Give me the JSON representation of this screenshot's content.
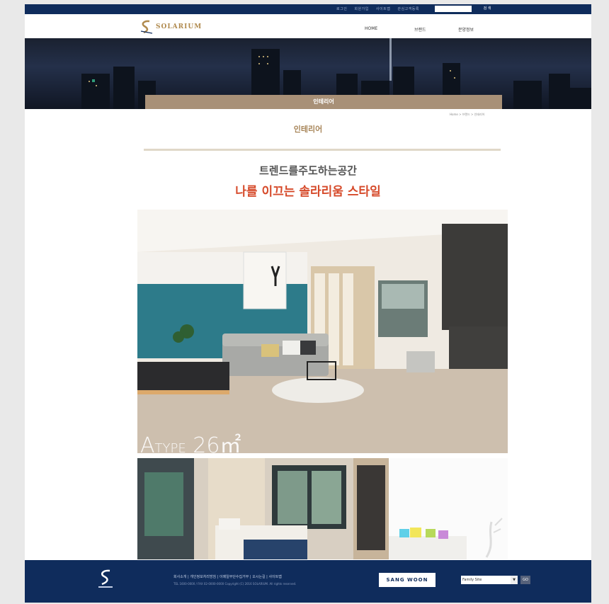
{
  "topbar": {
    "links": [
      "로그인",
      "회원가입",
      "사이트맵",
      "관심고객등록"
    ],
    "search_placeholder": "",
    "search_button": "검 색"
  },
  "header": {
    "logo_text": "SOLARIUM",
    "nav": [
      {
        "label": "HOME"
      },
      {
        "label": "브랜드"
      },
      {
        "label": "분양정보"
      }
    ]
  },
  "hero": {
    "tab_label": "인테리어"
  },
  "breadcrumb": "Home > 브랜드 > 인테리어",
  "section": {
    "title": "인테리어",
    "subtitle": "트렌드를주도하는공간",
    "headline": "나를 이끄는 솔라리움 스타일"
  },
  "photo": {
    "caption_prefix": "A",
    "caption_type": "TYPE",
    "caption_area": " 26㎡"
  },
  "footer": {
    "links": "회사소개  |  개인정보처리방침  |  이메일무단수집거부  |  오시는길  |  사이트맵",
    "copyright": "TEL 1600-0000 / FAX 02-0000-0000     Copyright (C) 2016 SOLARIUM. All rights reserved.",
    "family_logo": "SANG WOON",
    "family_select": "Family Site",
    "family_go": "GO"
  },
  "colors": {
    "navy": "#0f2c5c",
    "gold": "#a8865a",
    "red": "#d64a2a"
  }
}
